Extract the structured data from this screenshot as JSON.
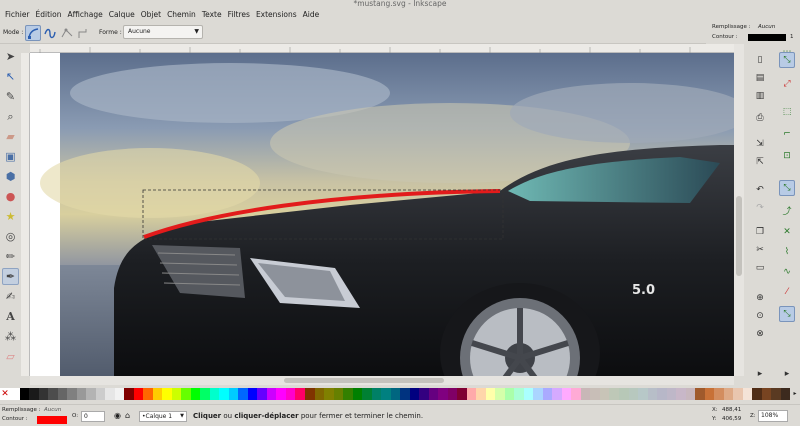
{
  "window": {
    "title": "*mustang.svg - Inkscape"
  },
  "menu": [
    "Fichier",
    "Édition",
    "Affichage",
    "Calque",
    "Objet",
    "Chemin",
    "Texte",
    "Filtres",
    "Extensions",
    "Aide"
  ],
  "toolbar": {
    "mode_label": "Mode :",
    "shape_label": "Forme :",
    "shape_value": "Aucune"
  },
  "style_indicator": {
    "fill_label": "Remplissage :",
    "fill_value": "Aucun",
    "stroke_label": "Contour :",
    "stroke_width": "1",
    "stroke_color": "#000000"
  },
  "tools": [
    "selector-icon",
    "node-icon",
    "tweak-icon",
    "zoom-icon",
    "measure-icon",
    "rect-icon",
    "3dbox-icon",
    "ellipse-icon",
    "star-icon",
    "spiral-icon",
    "pencil-icon",
    "pen-icon",
    "calligraphy-icon",
    "text-icon",
    "spray-icon",
    "eraser-icon"
  ],
  "palette_colors": [
    "#ffffff",
    "#000000",
    "#1a1a1a",
    "#333333",
    "#4d4d4d",
    "#666666",
    "#808080",
    "#999999",
    "#b3b3b3",
    "#cccccc",
    "#e6e6e6",
    "#f2f2f2",
    "#800000",
    "#ff0000",
    "#ff6600",
    "#ffcc00",
    "#ffff00",
    "#ccff00",
    "#66ff00",
    "#00ff00",
    "#00ff66",
    "#00ffcc",
    "#00ffff",
    "#00ccff",
    "#0066ff",
    "#0000ff",
    "#6600ff",
    "#cc00ff",
    "#ff00ff",
    "#ff00cc",
    "#ff0066",
    "#803300",
    "#806600",
    "#808000",
    "#668000",
    "#338000",
    "#008000",
    "#008033",
    "#008066",
    "#008080",
    "#006680",
    "#003380",
    "#000080",
    "#330080",
    "#660080",
    "#800080",
    "#800066",
    "#800033",
    "#ffaaaa",
    "#ffd5aa",
    "#ffffaa",
    "#d5ffaa",
    "#aaffaa",
    "#aaffd5",
    "#aaffff",
    "#aad5ff",
    "#aaaaff",
    "#d5aaff",
    "#ffaaff",
    "#ffaad5",
    "#c8b7b7",
    "#c8beb7",
    "#c8c4b7",
    "#bec8b7",
    "#b7c8b7",
    "#b7c8be",
    "#b7c8c8",
    "#b7bec8",
    "#b7b7c8",
    "#beb7c8",
    "#c8b7c8",
    "#c8b7be",
    "#a05a2c",
    "#c87137",
    "#d38d5f",
    "#deaa87",
    "#e9c6af",
    "#f4e3d7",
    "#502d16",
    "#784421",
    "#5a3a22",
    "#3c2a1e"
  ],
  "status": {
    "fill_label": "Remplissage :",
    "fill_value": "Aucun",
    "stroke_label": "Contour :",
    "stroke_color": "#ff0000",
    "opacity_label": "O:",
    "opacity_value": "0",
    "layer": "•Calque 1",
    "message_bold1": "Cliquer",
    "message_mid": " ou ",
    "message_bold2": "cliquer-déplacer",
    "message_rest": " pour fermer et terminer le chemin.",
    "x_label": "X:",
    "x_value": "488,41",
    "y_label": "Y:",
    "y_value": "406,59",
    "zoom_label": "Z:",
    "zoom_value": "108%"
  }
}
